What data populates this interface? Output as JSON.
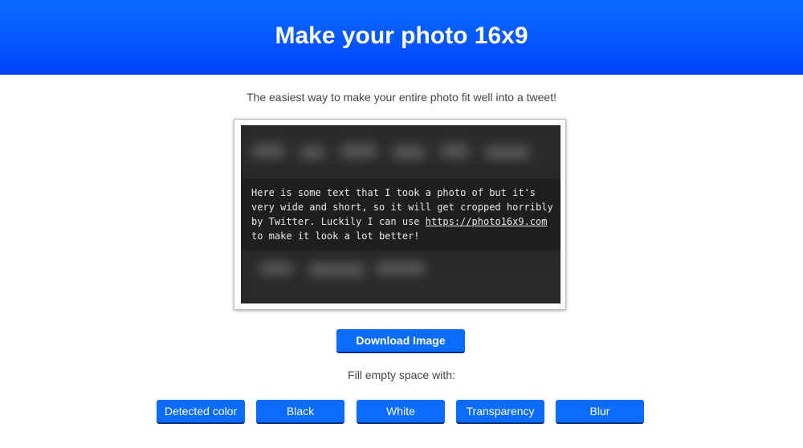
{
  "header": {
    "title": "Make your photo 16x9"
  },
  "tagline": "The easiest way to make your entire photo fit well into a tweet!",
  "preview": {
    "text_lines": [
      "Here is some text that I took a photo of but it's",
      "very wide and short, so it will get cropped horribly",
      "by Twitter. Luckily I can use ",
      "https://photo16x9.com",
      "to make it look a lot better!"
    ]
  },
  "download_button": {
    "label": "Download Image"
  },
  "fill": {
    "label": "Fill empty space with:",
    "options": [
      "Detected color",
      "Black",
      "White",
      "Transparency",
      "Blur"
    ]
  },
  "colors": {
    "accent": "#0a6cff",
    "header_top": "#0a6cff",
    "header_bottom": "#0044ff"
  }
}
